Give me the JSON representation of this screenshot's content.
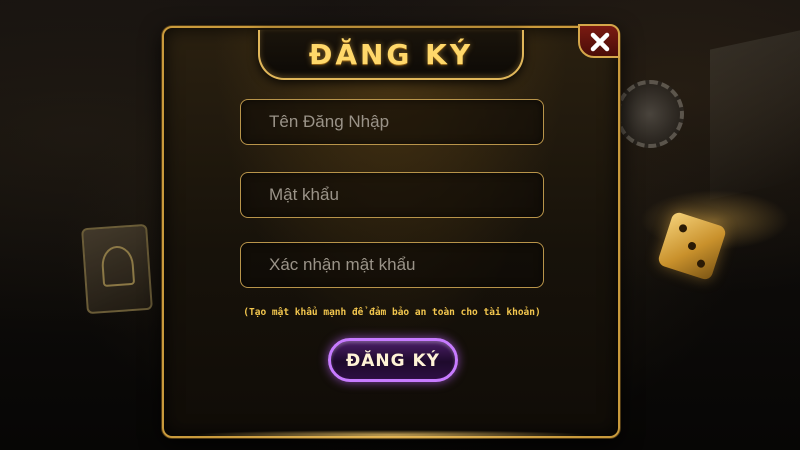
{
  "dialog": {
    "title": "ĐĂNG KÝ",
    "close_icon": "close-icon"
  },
  "form": {
    "username": {
      "placeholder": "Tên Đăng Nhập",
      "value": ""
    },
    "password": {
      "placeholder": "Mật khẩu",
      "value": ""
    },
    "confirm_password": {
      "placeholder": "Xác nhận mật khẩu",
      "value": ""
    },
    "hint": "(Tạo mật khẩu mạnh để đảm bảo an toàn cho tài khoản)",
    "submit_label": "ĐĂNG KÝ"
  },
  "colors": {
    "gold": "#ffd86a",
    "panel_border": "#c99a3c",
    "submit_border": "#c77bff",
    "close_bg": "#7a1a12"
  }
}
